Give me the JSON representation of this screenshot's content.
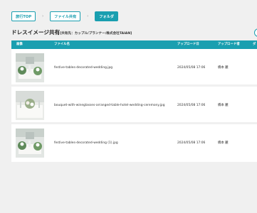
{
  "breadcrumb": {
    "items": [
      "旅行TOP",
      "ファイル共有",
      "フォルダ"
    ],
    "separator": "›"
  },
  "page": {
    "title": "ドレスイメージ共有",
    "subtitle": "[共有先：カップル/プランナー/株式会社TAIAN]"
  },
  "table": {
    "headers": {
      "image": "画像",
      "filename": "ファイル名",
      "upload_date": "アップロード日",
      "uploader": "アップロード者",
      "download": "ダ"
    },
    "rows": [
      {
        "filename": "festive-tables-decorated-wedding.jpg",
        "upload_date": "2024/05/08 17:06",
        "uploader": "橋本 麗"
      },
      {
        "filename": "bouquet-with-wineglasses-arranged-table-hotel-wedding-ceremony.jpg",
        "upload_date": "2024/05/08 17:06",
        "uploader": "橋本 麗"
      },
      {
        "filename": "festive-tables-decorated-wedding (1).jpg",
        "upload_date": "2024/05/08 17:06",
        "uploader": "橋本 麗"
      }
    ]
  },
  "colors": {
    "accent": "#1a9fb0",
    "background": "#f0f0f0"
  }
}
